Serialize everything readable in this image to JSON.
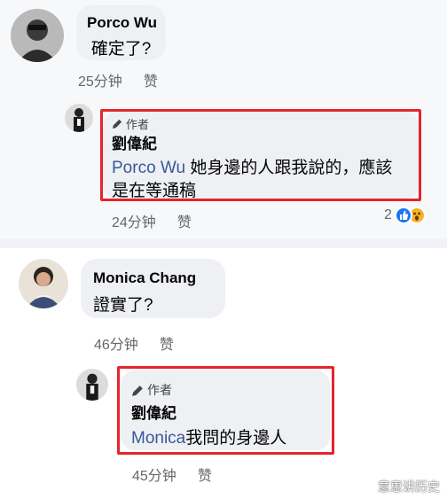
{
  "comments": [
    {
      "author": "Porco Wu",
      "text": "確定了?",
      "time": "25分钟",
      "like_label": "赞",
      "reply": {
        "author_badge": "作者",
        "author": "劉偉紀",
        "mention": "Porco Wu",
        "text_line1": " 她身邊的人跟我說的，應該",
        "text_line2": "是在等通稿",
        "time": "24分钟",
        "like_label": "赞",
        "reaction_count": "2"
      }
    },
    {
      "author": "Monica Chang",
      "text": "證實了?",
      "time": "46分钟",
      "like_label": "赞",
      "reply": {
        "author_badge": "作者",
        "author": "劉偉紀",
        "mention": "Monica",
        "text": "我問的身邊人",
        "time": "45分钟",
        "like_label": "赞"
      }
    }
  ],
  "watermark": "意恵讲历史",
  "colors": {
    "highlight": "#e5242c",
    "mention": "#385898",
    "like": "#1877f2",
    "wow": "#f7b125"
  },
  "icons": [
    "pencil-icon",
    "like-reaction-icon",
    "wow-reaction-icon"
  ]
}
